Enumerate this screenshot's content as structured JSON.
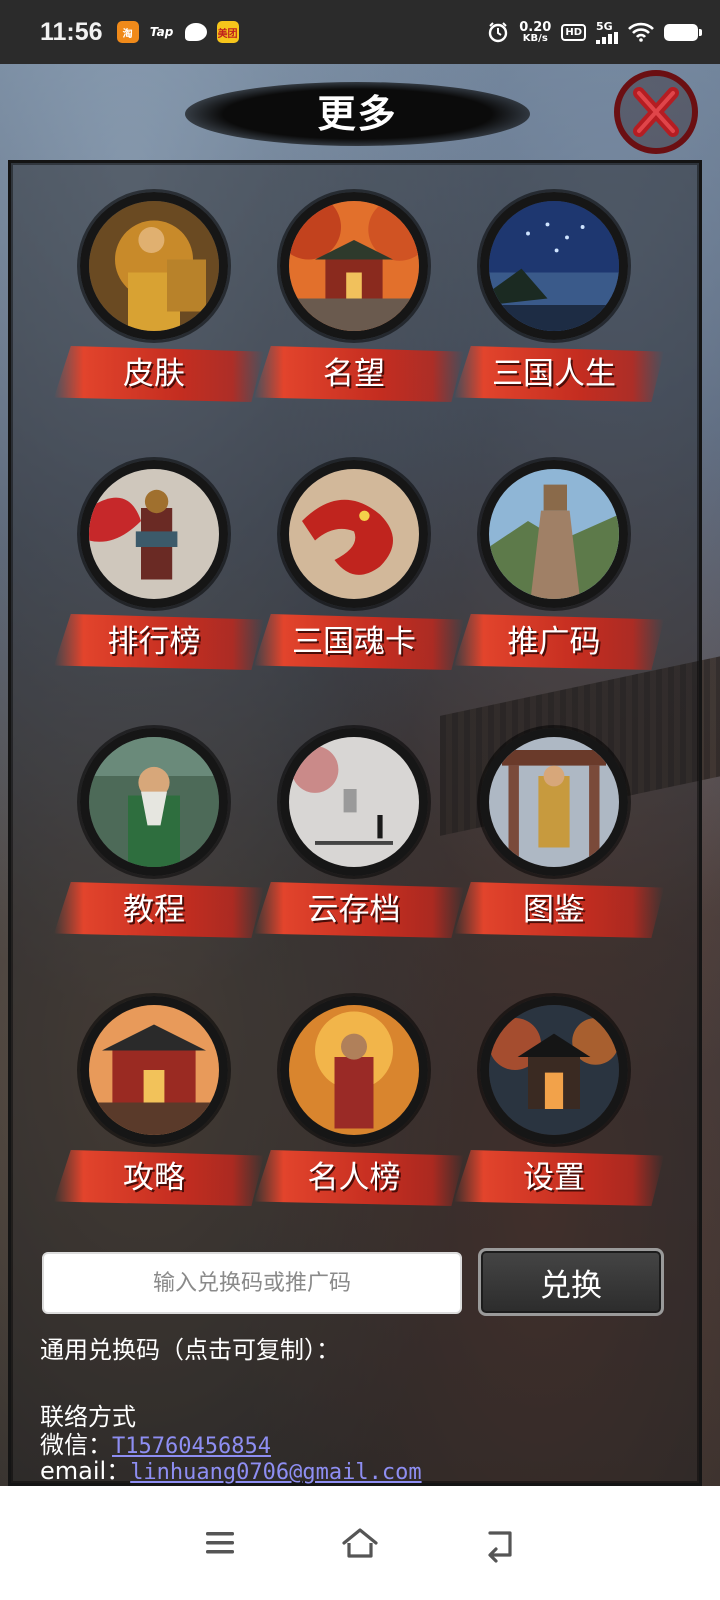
{
  "status_bar": {
    "time": "11:56",
    "notif_icons": [
      {
        "icon": "taobao-app-icon",
        "text": "淘"
      },
      {
        "icon": "tap-app-icon",
        "text": "Tap"
      },
      {
        "icon": "message-app-icon",
        "text": ""
      },
      {
        "icon": "meituan-app-icon",
        "text": "美团"
      }
    ],
    "speed_value": "0.20",
    "speed_unit": "KB/s",
    "hd": "HD",
    "network": "5G",
    "icons": [
      "alarm-icon",
      "signal-icon",
      "wifi-icon",
      "battery-icon"
    ]
  },
  "header": {
    "title": "更多",
    "close_icon": "close-icon"
  },
  "menu": [
    {
      "label": "皮肤",
      "icon": "general-portrait"
    },
    {
      "label": "名望",
      "icon": "palace-gate"
    },
    {
      "label": "三国人生",
      "icon": "starry-night"
    },
    {
      "label": "排行榜",
      "icon": "armored-warrior"
    },
    {
      "label": "三国魂卡",
      "icon": "red-dragon"
    },
    {
      "label": "推广码",
      "icon": "great-wall"
    },
    {
      "label": "教程",
      "icon": "sage-elder"
    },
    {
      "label": "云存档",
      "icon": "misty-swordsman"
    },
    {
      "label": "图鉴",
      "icon": "temple-emperor"
    },
    {
      "label": "攻略",
      "icon": "burning-palace"
    },
    {
      "label": "名人榜",
      "icon": "fiery-general"
    },
    {
      "label": "设置",
      "icon": "night-pavilion"
    }
  ],
  "redeem": {
    "placeholder": "输入兑换码或推广码",
    "button_label": "兑换"
  },
  "info": {
    "codes_label": "通用兑换码（点击可复制）：",
    "contact_label": "联络方式",
    "wechat_label": "微信：",
    "wechat_value": "T15760456854",
    "email_label": "email：",
    "email_value": "linhuang0706@gmail.com"
  },
  "nav_bar": {
    "icons": [
      "menu-icon",
      "home-icon",
      "back-icon"
    ]
  },
  "colors": {
    "ribbon_red": "#d9392a",
    "close_red": "#8a1216",
    "link_purple": "#8e8ef2"
  }
}
